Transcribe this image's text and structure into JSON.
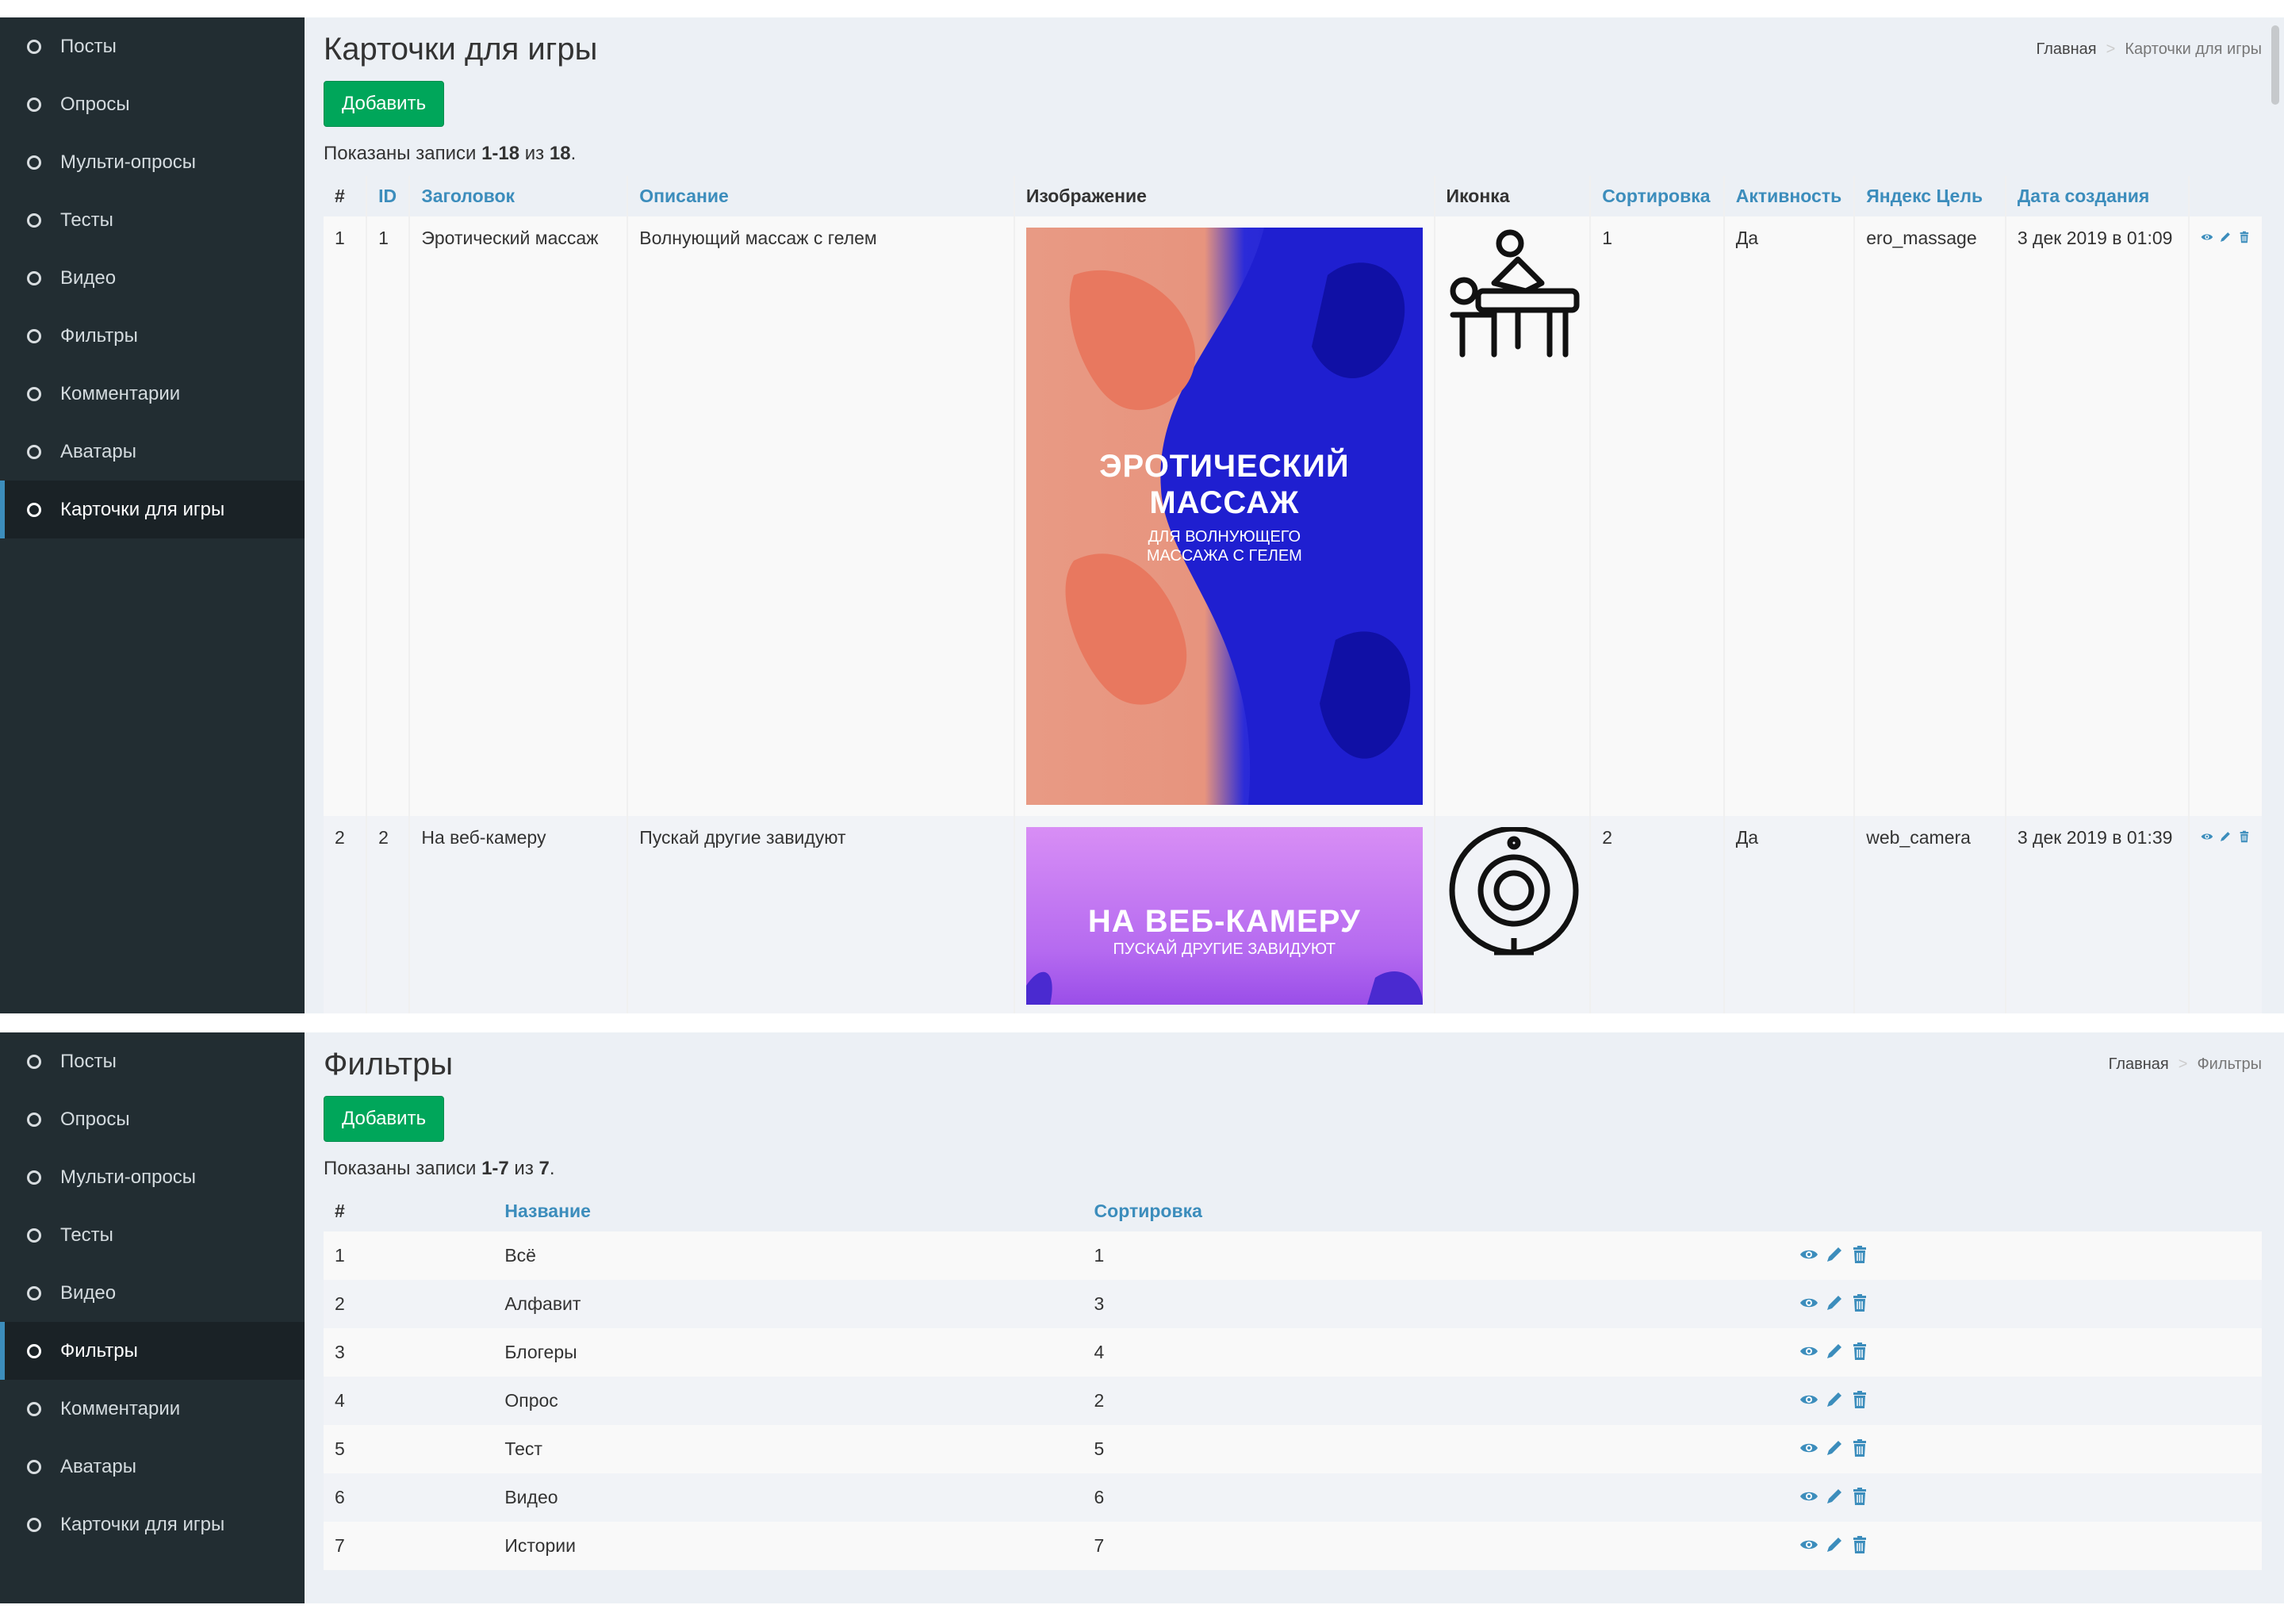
{
  "sidebar": {
    "items": [
      {
        "label": "Посты"
      },
      {
        "label": "Опросы"
      },
      {
        "label": "Мульти-опросы"
      },
      {
        "label": "Тесты"
      },
      {
        "label": "Видео"
      },
      {
        "label": "Фильтры"
      },
      {
        "label": "Комментарии"
      },
      {
        "label": "Аватары"
      },
      {
        "label": "Карточки для игры"
      }
    ],
    "active_top": "Карточки для игры",
    "active_bottom": "Фильтры"
  },
  "cards_page": {
    "title": "Карточки для игры",
    "breadcrumb": {
      "home": "Главная",
      "current": "Карточки для игры"
    },
    "add_label": "Добавить",
    "summary": {
      "prefix": "Показаны записи ",
      "range": "1-18",
      "middle": " из ",
      "total": "18",
      "suffix": "."
    },
    "columns": [
      "#",
      "ID",
      "Заголовок",
      "Описание",
      "Изображение",
      "Иконка",
      "Сортировка",
      "Активность",
      "Яндекс Цель",
      "Дата создания"
    ],
    "rows": [
      {
        "num": "1",
        "id": "1",
        "title": "Эротический массаж",
        "description": "Волнующий массаж с гелем",
        "image": {
          "title_line1": "ЭРОТИЧЕСКИЙ",
          "title_line2": "МАССАЖ",
          "sub_line1": "ДЛЯ ВОЛНУЮЩЕГО",
          "sub_line2": "МАССАЖА С ГЕЛЕМ"
        },
        "icon": "massage-table-icon",
        "sort": "1",
        "active": "Да",
        "goal": "ero_massage",
        "created": "3 дек 2019 в 01:09"
      },
      {
        "num": "2",
        "id": "2",
        "title": "На веб-камеру",
        "description": "Пускай другие завидуют",
        "image": {
          "title_line1": "НА ВЕБ-КАМЕРУ",
          "sub_line1": "ПУСКАЙ ДРУГИЕ ЗАВИДУЮТ"
        },
        "icon": "webcam-icon",
        "sort": "2",
        "active": "Да",
        "goal": "web_camera",
        "created": "3 дек 2019 в 01:39"
      }
    ]
  },
  "filters_page": {
    "title": "Фильтры",
    "breadcrumb": {
      "home": "Главная",
      "current": "Фильтры"
    },
    "add_label": "Добавить",
    "summary": {
      "prefix": "Показаны записи ",
      "range": "1-7",
      "middle": " из ",
      "total": "7",
      "suffix": "."
    },
    "columns": [
      "#",
      "Название",
      "Сортировка"
    ],
    "rows": [
      {
        "num": "1",
        "name": "Всё",
        "sort": "1"
      },
      {
        "num": "2",
        "name": "Алфавит",
        "sort": "3"
      },
      {
        "num": "3",
        "name": "Блогеры",
        "sort": "4"
      },
      {
        "num": "4",
        "name": "Опрос",
        "sort": "2"
      },
      {
        "num": "5",
        "name": "Тест",
        "sort": "5"
      },
      {
        "num": "6",
        "name": "Видео",
        "sort": "6"
      },
      {
        "num": "7",
        "name": "Истории",
        "sort": "7"
      }
    ]
  },
  "colors": {
    "sidebar_bg": "#222d32",
    "accent": "#3c8dbc",
    "add_button": "#00a65a",
    "content_bg": "#ecf0f5"
  }
}
